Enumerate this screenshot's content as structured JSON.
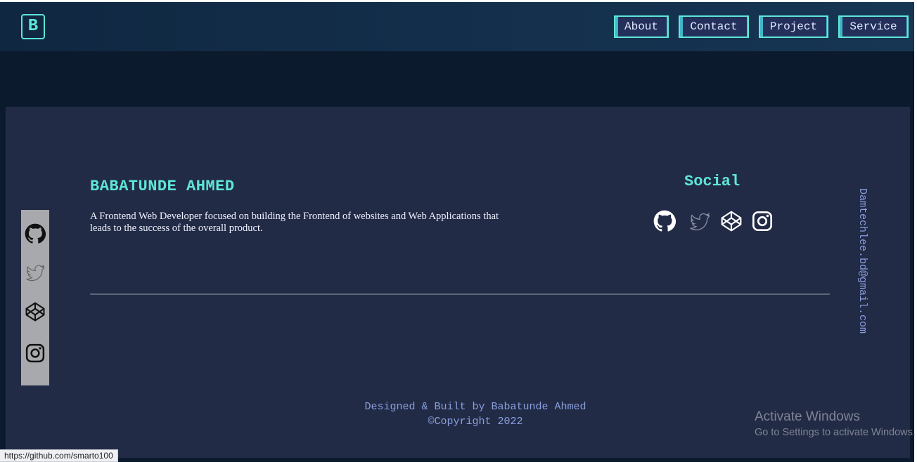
{
  "header": {
    "logo_text": "B",
    "nav": [
      {
        "label": "About"
      },
      {
        "label": "Contact"
      },
      {
        "label": "Project"
      },
      {
        "label": "Service"
      }
    ]
  },
  "side_social": {
    "icons": [
      "github-icon",
      "twitter-icon",
      "codepen-icon",
      "instagram-icon"
    ]
  },
  "about": {
    "name": "BABATUNDE AHMED",
    "description": "A Frontend Web Developer focused on building the Frontend of websites and Web Applications that leads to the success of the overall product."
  },
  "social": {
    "title": "Social",
    "icons": [
      "github-icon",
      "twitter-icon",
      "codepen-icon",
      "instagram-icon"
    ]
  },
  "email": "Damtechlee.bd@gmail.com",
  "footer": {
    "credit": "Designed & Built by Babatunde Ahmed",
    "copyright": "©Copyright 2022"
  },
  "windows_watermark": {
    "title": "Activate Windows",
    "subtitle": "Go to Settings to activate Windows."
  },
  "status_bar": {
    "url": "https://github.com/smarto100"
  },
  "colors": {
    "accent": "#5ee7d6",
    "background": "#0c1a2e",
    "panel": "#222b45",
    "link_text": "#8a9fe0"
  }
}
